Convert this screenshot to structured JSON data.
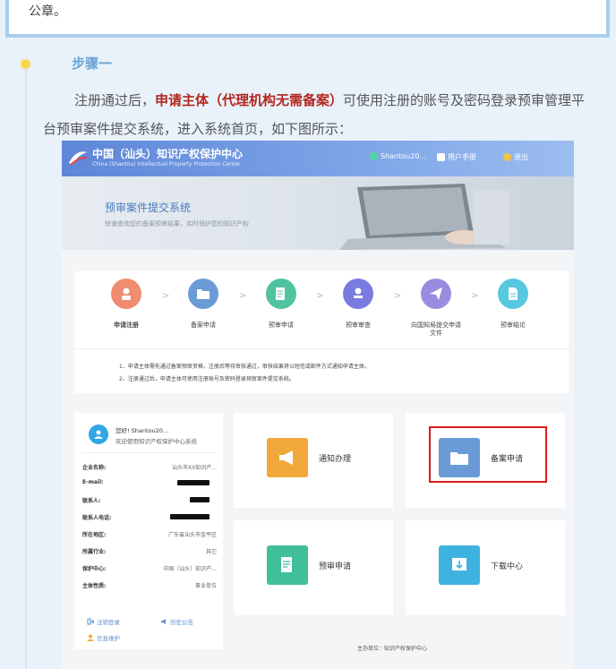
{
  "top_text": "公章。",
  "step": {
    "title": "步骤一",
    "para_before": "注册通过后，",
    "para_highlight": "申请主体（代理机构无需备案）",
    "para_after": "可使用注册的账号及密码登录预审管理平台预审案件提交系统，进入系统首页，如下图所示："
  },
  "app": {
    "title": "中国（汕头）知识产权保护中心",
    "subtitle": "China (Shantou) Intellectual Property Protection Center",
    "header_items": [
      {
        "label": "Shantou20...",
        "icon": "user-icon",
        "color": "#4fd6a0"
      },
      {
        "label": "用户手册",
        "icon": "book-icon",
        "color": "#ffffff"
      },
      {
        "label": "退出",
        "icon": "power-icon",
        "color": "#f5c342"
      }
    ],
    "banner": {
      "title": "预审案件提交系统",
      "subtitle": "快速查询您的备案预审结果，实时保护您的知识产权"
    },
    "steps": [
      {
        "label": "申请注册",
        "icon": "user-icon",
        "color": "#f08c6f"
      },
      {
        "label": "备案申请",
        "icon": "folder-icon",
        "color": "#6b9bd6"
      },
      {
        "label": "预审申请",
        "icon": "document-icon",
        "color": "#4fc3a0"
      },
      {
        "label": "预审审查",
        "icon": "stamp-icon",
        "color": "#7a7be0"
      },
      {
        "label": "向国知局提交申请文件",
        "icon": "send-icon",
        "color": "#9b8be0"
      },
      {
        "label": "预审结论",
        "icon": "file-icon",
        "color": "#58c7e0"
      }
    ],
    "notes": [
      "1、申请主体需先通过备案预审资格，注册后等待审核通过，审核结果将以短信或邮件方式通知申请主体。",
      "2、注册通过后，申请主体可使用注册账号及密码登录预审案件提交系统。"
    ],
    "profile": {
      "name": "您好! Shantou20...",
      "welcome": "欢迎使用知识产权保护中心系统",
      "rows": [
        {
          "key": "企业名称:",
          "value": "汕头市XX知识产..."
        },
        {
          "key": "E-mail:",
          "value": ""
        },
        {
          "key": "联系人:",
          "value": ""
        },
        {
          "key": "联系人电话:",
          "value": ""
        },
        {
          "key": "所在地区:",
          "value": "广东省汕头市金平区"
        },
        {
          "key": "所属行业:",
          "value": "其它"
        },
        {
          "key": "保护中心:",
          "value": "中国（汕头）知识产..."
        },
        {
          "key": "主体性质:",
          "value": "事业单位"
        }
      ],
      "links": {
        "logout": "注销登录",
        "history": "历史公告",
        "info": "信息维护"
      }
    },
    "cards": [
      {
        "label": "通知办理",
        "icon": "megaphone-icon",
        "color": "#f0a93a"
      },
      {
        "label": "备案申请",
        "icon": "folder-icon",
        "color": "#6b9bd6"
      },
      {
        "label": "预审申请",
        "icon": "document-icon",
        "color": "#3fbf9a"
      },
      {
        "label": "下载中心",
        "icon": "download-icon",
        "color": "#3fb3e0"
      }
    ],
    "footer": "主办单位：知识产权保护中心"
  }
}
